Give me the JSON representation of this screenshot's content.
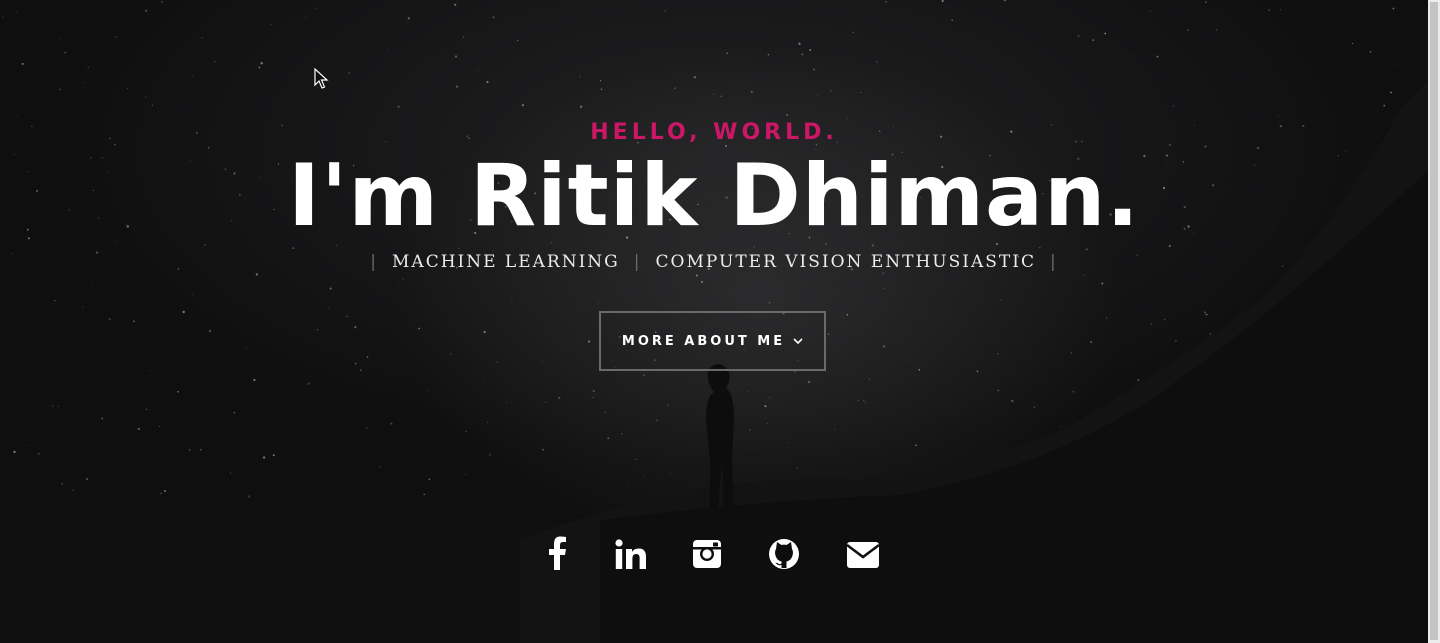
{
  "hero": {
    "greeting": "HELLO, WORLD.",
    "headline": "I'm Ritik Dhiman.",
    "roles": [
      "MACHINE LEARNING",
      "COMPUTER VISION ENTHUSIASTIC"
    ],
    "separator": "|",
    "more_button_label": "MORE ABOUT ME"
  },
  "social": {
    "icons": [
      "facebook-icon",
      "linkedin-icon",
      "instagram-icon",
      "github-icon",
      "email-icon"
    ]
  },
  "colors": {
    "accent": "#cc1766",
    "background": "#0e0e0f",
    "text": "#ffffff"
  }
}
